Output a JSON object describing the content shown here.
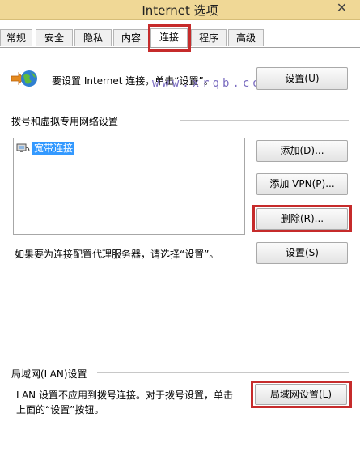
{
  "window": {
    "title": "Internet 选项",
    "close_glyph": "✕"
  },
  "tabs": [
    {
      "label": "常规"
    },
    {
      "label": "安全"
    },
    {
      "label": "隐私"
    },
    {
      "label": "内容"
    },
    {
      "label": "连接"
    },
    {
      "label": "程序"
    },
    {
      "label": "高级"
    }
  ],
  "setup": {
    "text": "要设置 Internet 连接，单击“设置”。",
    "button": "设置(U)"
  },
  "watermark": "www.xrqb.com",
  "dialup": {
    "heading": "拨号和虚拟专用网络设置",
    "connections": [
      {
        "name": "宽带连接",
        "selected": true
      }
    ],
    "add_button": "添加(D)...",
    "add_vpn_button": "添加 VPN(P)...",
    "remove_button": "删除(R)...",
    "proxy_text": "如果要为连接配置代理服务器，请选择“设置”。",
    "settings_button": "设置(S)"
  },
  "lan": {
    "heading": "局域网(LAN)设置",
    "text_line1": "LAN 设置不应用到拨号连接。对于拨号设置，单击",
    "text_line2": "上面的“设置”按钮。",
    "button": "局域网设置(L)"
  },
  "colors": {
    "highlight": "#c62b2b",
    "selection": "#3399ff",
    "titlebar": "#f0d896"
  }
}
